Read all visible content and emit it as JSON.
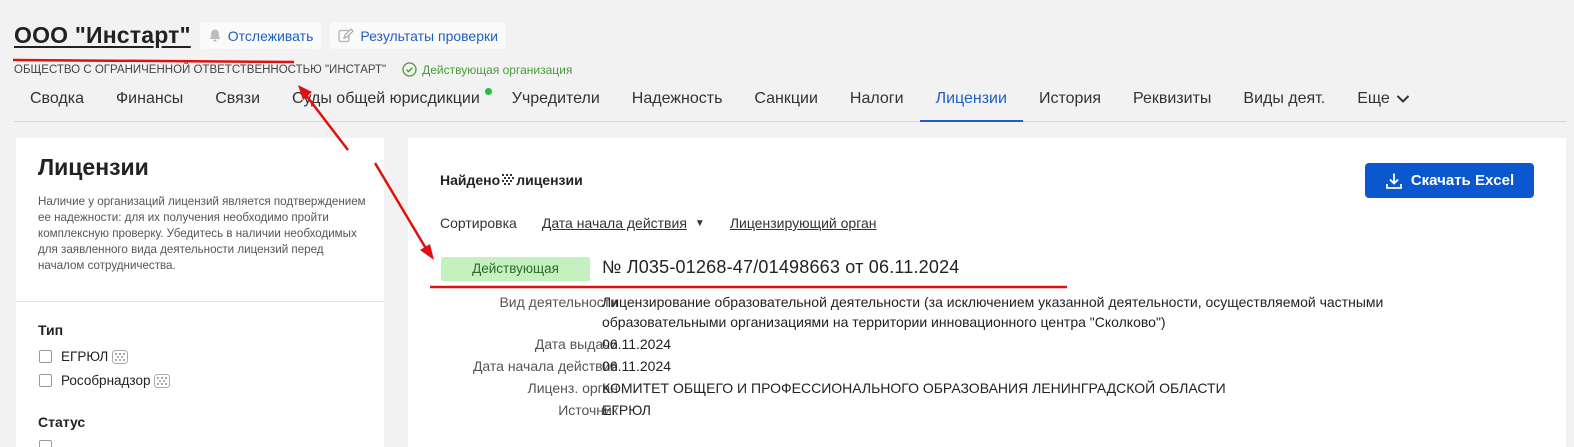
{
  "company": {
    "title": "ООО \"Инстарт\"",
    "full_name": "ОБЩЕСТВО С ОГРАНИЧЕННОЙ ОТВЕТСТВЕННОСТЬЮ \"ИНСТАРТ\"",
    "status": "Действующая организация"
  },
  "header_buttons": {
    "track": "Отслеживать",
    "check_results": "Результаты проверки"
  },
  "tabs": [
    {
      "label": "Сводка"
    },
    {
      "label": "Финансы"
    },
    {
      "label": "Связи"
    },
    {
      "label": "Суды общей юрисдикции"
    },
    {
      "label": "Учредители"
    },
    {
      "label": "Надежность"
    },
    {
      "label": "Санкции"
    },
    {
      "label": "Налоги"
    },
    {
      "label": "Лицензии"
    },
    {
      "label": "История"
    },
    {
      "label": "Реквизиты"
    },
    {
      "label": "Виды деят."
    },
    {
      "label": "Еще"
    }
  ],
  "sidebar": {
    "title": "Лицензии",
    "description": "Наличие у организаций лицензий является подтверждением ее надежности: для их получения необходимо пройти комплексную проверку. Убедитесь в наличии необходимых для заявленного вида деятельности лицензий перед началом сотрудничества.",
    "type_heading": "Тип",
    "type_options": [
      "ЕГРЮЛ",
      "Рособрнадзор"
    ],
    "status_heading": "Статус"
  },
  "main": {
    "found_prefix": "Найдено",
    "found_suffix": "лицензии",
    "download_label": "Скачать Excel",
    "sort_label": "Сортировка",
    "sort_option_1": "Дата начала действия",
    "sort_option_2": "Лицензирующий орган"
  },
  "license": {
    "status": "Действующая",
    "number": "№ Л035-01268-47/01498663 от 06.11.2024",
    "activity_label": "Вид деятельности",
    "activity_value": "Лицензирование образовательной деятельности (за исключением указанной деятельности, осуществляемой частными образовательными организациями на территории инновационного центра \"Сколково\")",
    "issue_date_label": "Дата выдачи",
    "issue_date_value": "06.11.2024",
    "start_date_label": "Дата начала действия",
    "start_date_value": "06.11.2024",
    "authority_label": "Лиценз. орган",
    "authority_value": "КОМИТЕТ ОБЩЕГО И ПРОФЕССИОНАЛЬНОГО ОБРАЗОВАНИЯ ЛЕНИНГРАДСКОЙ ОБЛАСТИ",
    "source_label": "Источник",
    "source_value": "ЕГРЮЛ"
  },
  "colors": {
    "accent": "#0b57d0",
    "tab_active": "#1f5fc2",
    "badge_bg": "#c5f1c1",
    "status_green": "#4a9b3a",
    "annotation_red": "#e01010"
  }
}
